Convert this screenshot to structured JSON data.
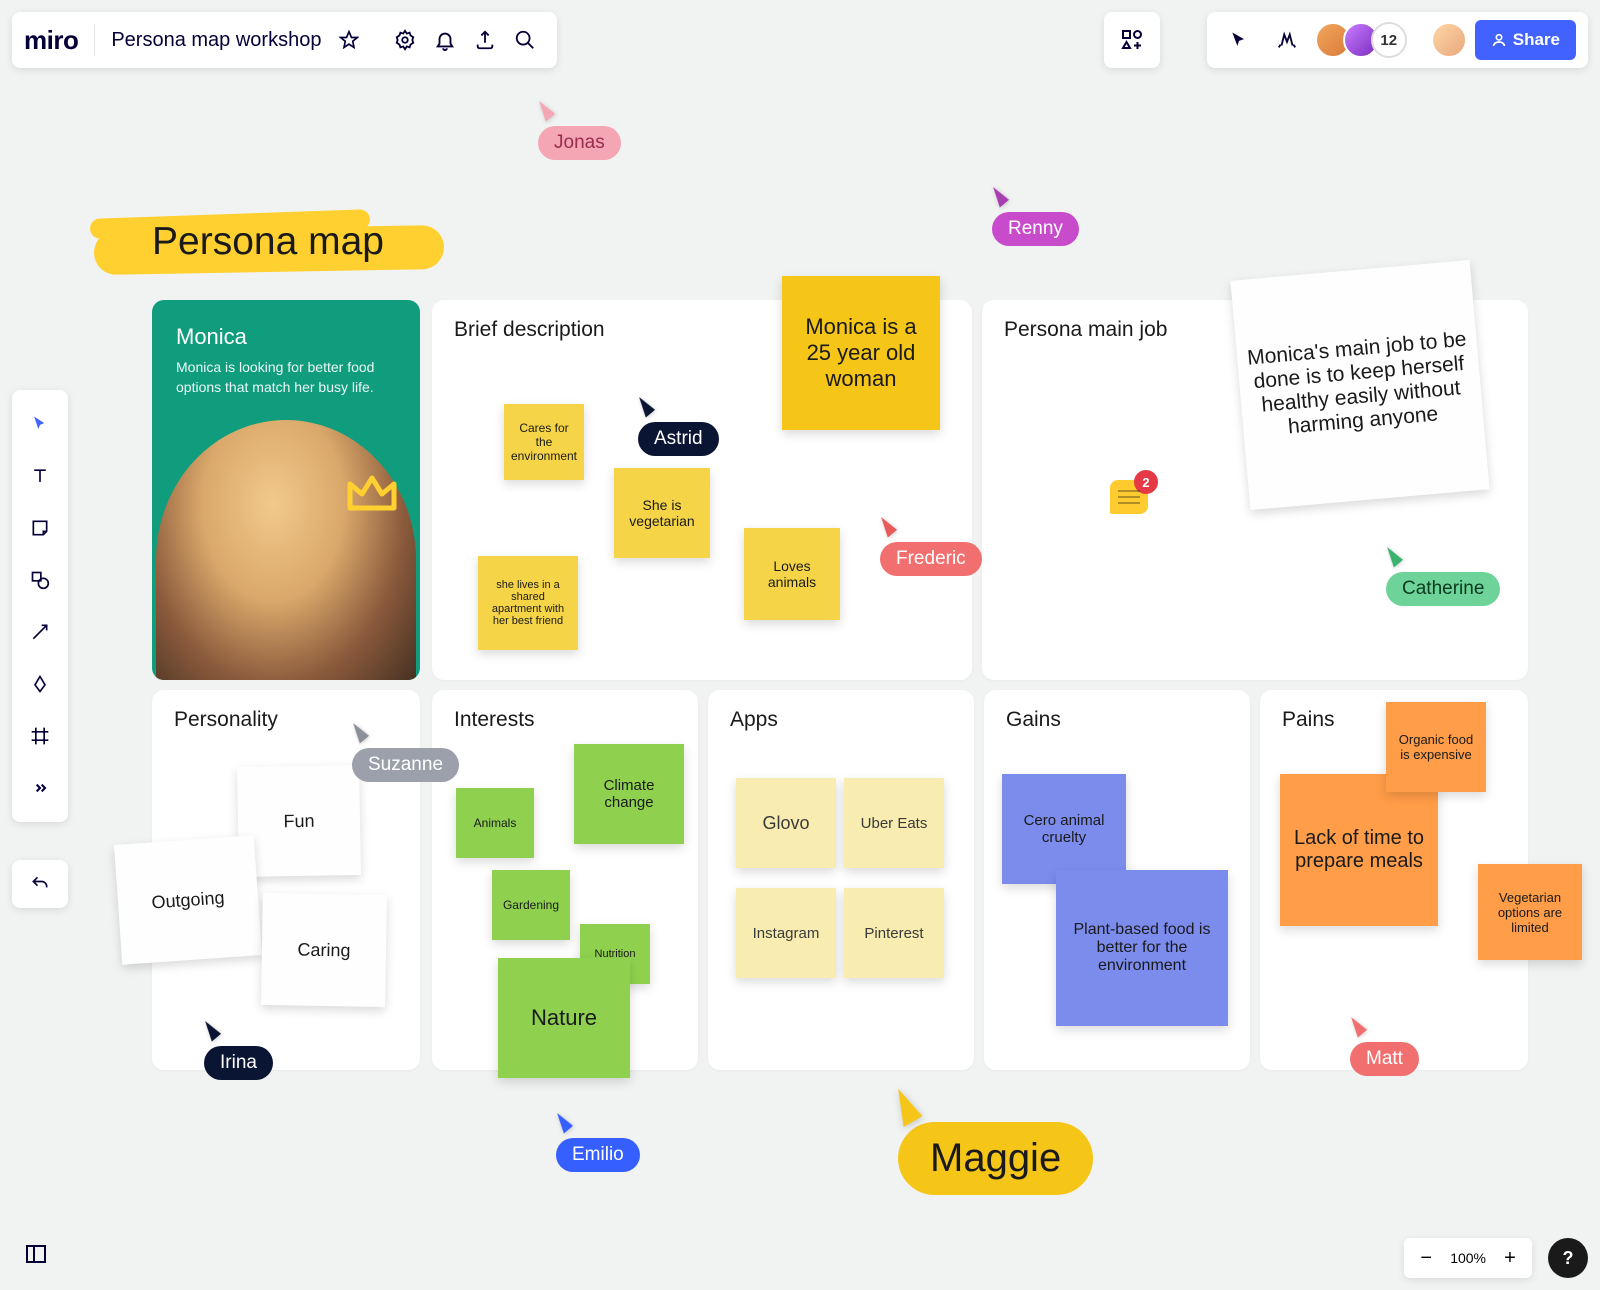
{
  "header": {
    "logo": "miro",
    "board_title": "Persona map workshop",
    "avatar_count": "12",
    "share_label": "Share"
  },
  "zoom": {
    "level": "100%",
    "help": "?"
  },
  "canvas": {
    "title": "Persona map",
    "persona": {
      "name": "Monica",
      "desc": "Monica is looking for better food options that match her busy life."
    },
    "frames": {
      "brief": "Brief description",
      "mainjob": "Persona main job",
      "personality": "Personality",
      "interests": "Interests",
      "apps": "Apps",
      "gains": "Gains",
      "pains": "Pains"
    },
    "notes": {
      "monica_age": "Monica is a 25 year old woman",
      "cares_env": "Cares for the environment",
      "vegetarian": "She is vegetarian",
      "shared_apt": "she lives in a shared apartment with her best friend",
      "loves_animals": "Loves animals",
      "main_job_text": "Monica's main job to be done is to keep herself healthy easily without harming anyone",
      "fun": "Fun",
      "outgoing": "Outgoing",
      "caring": "Caring",
      "animals": "Animals",
      "gardening": "Gardening",
      "climate": "Climate change",
      "nutrition": "Nutrition",
      "nature": "Nature",
      "glovo": "Glovo",
      "uber_eats": "Uber Eats",
      "instagram": "Instagram",
      "pinterest": "Pinterest",
      "cero_cruelty": "Cero animal cruelty",
      "plant_based": "Plant-based food is better for the environment",
      "lack_time": "Lack of time to prepare meals",
      "organic_exp": "Organic food is expensive",
      "veg_limited": "Vegetarian options are limited"
    },
    "comment_count": "2",
    "cursors": {
      "jonas": "Jonas",
      "renny": "Renny",
      "astrid": "Astrid",
      "frederic": "Frederic",
      "catherine": "Catherine",
      "suzanne": "Suzanne",
      "irina": "Irina",
      "emilio": "Emilio",
      "maggie": "Maggie",
      "matt": "Matt"
    }
  }
}
